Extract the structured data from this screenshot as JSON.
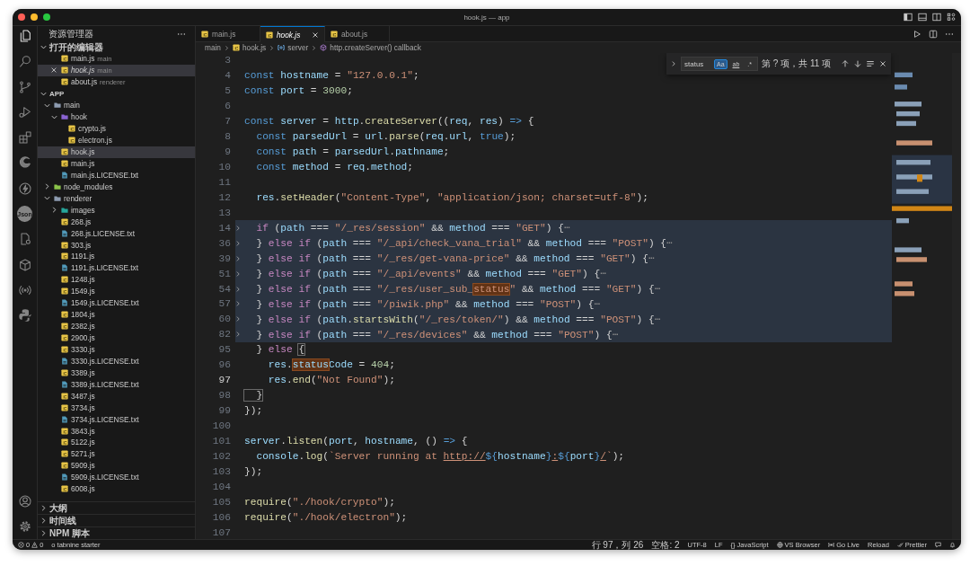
{
  "window": {
    "title": "hook.js — app"
  },
  "activity_bar": {
    "items": [
      {
        "kind": "explorer",
        "selected": true
      },
      {
        "kind": "search",
        "selected": false
      },
      {
        "kind": "source-control",
        "selected": false
      },
      {
        "kind": "run-debug",
        "selected": false
      },
      {
        "kind": "extensions",
        "selected": false
      },
      {
        "kind": "browser",
        "selected": false
      },
      {
        "kind": "lightning",
        "selected": false
      },
      {
        "kind": "json",
        "label": "Json",
        "selected": false
      },
      {
        "kind": "doc-gear",
        "selected": false
      },
      {
        "kind": "deploy",
        "selected": false
      },
      {
        "kind": "broadcast",
        "selected": false
      },
      {
        "kind": "python",
        "selected": false
      }
    ],
    "bottom": [
      {
        "kind": "account"
      },
      {
        "kind": "settings"
      }
    ]
  },
  "sidebar": {
    "title": "资源管理器",
    "open_editors": {
      "title": "打开的编辑器",
      "expanded": true,
      "items": [
        {
          "name": "main.js",
          "description": "main",
          "selected": false,
          "preview": false
        },
        {
          "name": "hook.js",
          "description": "main",
          "selected": true,
          "preview": true
        },
        {
          "name": "about.js",
          "description": "renderer",
          "selected": false,
          "preview": false
        }
      ]
    },
    "explorer": {
      "title": "APP",
      "expanded": true,
      "tree": [
        {
          "name": "main",
          "kind": "folder",
          "color": "#8d9bb0",
          "expanded": true,
          "selected": false,
          "children": [
            {
              "name": "hook",
              "kind": "folder",
              "color": "#8a63d2",
              "expanded": true,
              "selected": false,
              "children": [
                {
                  "name": "crypto.js",
                  "kind": "js",
                  "selected": false
                },
                {
                  "name": "electron.js",
                  "kind": "js",
                  "selected": false
                }
              ]
            },
            {
              "name": "hook.js",
              "kind": "js",
              "selected": true
            },
            {
              "name": "main.js",
              "kind": "js",
              "selected": false
            },
            {
              "name": "main.js.LICENSE.txt",
              "kind": "txt",
              "selected": false
            }
          ]
        },
        {
          "name": "node_modules",
          "kind": "folder",
          "color": "#8bc34a",
          "expanded": false,
          "selected": false
        },
        {
          "name": "renderer",
          "kind": "folder",
          "color": "#8d9bb0",
          "expanded": true,
          "selected": false,
          "children": [
            {
              "name": "images",
              "kind": "folder",
              "color": "#26a69a",
              "expanded": false,
              "selected": false
            },
            {
              "name": "268.js",
              "kind": "js",
              "selected": false
            },
            {
              "name": "268.js.LICENSE.txt",
              "kind": "txt",
              "selected": false
            },
            {
              "name": "303.js",
              "kind": "js",
              "selected": false
            },
            {
              "name": "1191.js",
              "kind": "js",
              "selected": false
            },
            {
              "name": "1191.js.LICENSE.txt",
              "kind": "txt",
              "selected": false
            },
            {
              "name": "1248.js",
              "kind": "js",
              "selected": false
            },
            {
              "name": "1549.js",
              "kind": "js",
              "selected": false
            },
            {
              "name": "1549.js.LICENSE.txt",
              "kind": "txt",
              "selected": false
            },
            {
              "name": "1804.js",
              "kind": "js",
              "selected": false
            },
            {
              "name": "2382.js",
              "kind": "js",
              "selected": false
            },
            {
              "name": "2900.js",
              "kind": "js",
              "selected": false
            },
            {
              "name": "3330.js",
              "kind": "js",
              "selected": false
            },
            {
              "name": "3330.js.LICENSE.txt",
              "kind": "txt",
              "selected": false
            },
            {
              "name": "3389.js",
              "kind": "js",
              "selected": false
            },
            {
              "name": "3389.js.LICENSE.txt",
              "kind": "txt",
              "selected": false
            },
            {
              "name": "3487.js",
              "kind": "js",
              "selected": false
            },
            {
              "name": "3734.js",
              "kind": "js",
              "selected": false
            },
            {
              "name": "3734.js.LICENSE.txt",
              "kind": "txt",
              "selected": false
            },
            {
              "name": "3843.js",
              "kind": "js",
              "selected": false
            },
            {
              "name": "5122.js",
              "kind": "js",
              "selected": false
            },
            {
              "name": "5271.js",
              "kind": "js",
              "selected": false
            },
            {
              "name": "5909.js",
              "kind": "js",
              "selected": false
            },
            {
              "name": "5909.js.LICENSE.txt",
              "kind": "txt",
              "selected": false
            },
            {
              "name": "6008.js",
              "kind": "js",
              "selected": false
            }
          ]
        }
      ]
    },
    "panels": [
      {
        "title": "大纲",
        "expanded": false
      },
      {
        "title": "时间线",
        "expanded": false
      },
      {
        "title": "NPM 脚本",
        "expanded": false
      }
    ]
  },
  "tabs": [
    {
      "label": "main.js",
      "selected": false,
      "preview": false
    },
    {
      "label": "hook.js",
      "selected": true,
      "preview": true
    },
    {
      "label": "about.js",
      "selected": false,
      "preview": false
    }
  ],
  "breadcrumbs": [
    {
      "label": "main",
      "kind": "folder"
    },
    {
      "label": "hook.js",
      "kind": "js"
    },
    {
      "label": "server",
      "kind": "variable"
    },
    {
      "label": "http.createServer() callback",
      "kind": "function"
    }
  ],
  "find": {
    "value": "status",
    "options": [
      {
        "kind": "case",
        "label": "Aa",
        "on": true
      },
      {
        "kind": "word",
        "label": "ab",
        "on": false
      },
      {
        "kind": "regex",
        "label": ".*",
        "on": false
      }
    ],
    "result": "第 ? 项，共 11 项"
  },
  "code": {
    "lines": [
      {
        "number": "3",
        "highlighted": false,
        "folded": false,
        "current": false
      },
      {
        "number": "4",
        "highlighted": false,
        "folded": false,
        "current": false,
        "tokens": [
          {
            "kind": "k",
            "text": "const "
          },
          {
            "kind": "v",
            "text": "hostname"
          },
          {
            "kind": "p",
            "text": " = "
          },
          {
            "kind": "s",
            "text": "\"127.0.0.1\""
          },
          {
            "kind": "p",
            "text": ";"
          }
        ]
      },
      {
        "number": "5",
        "highlighted": false,
        "folded": false,
        "current": false,
        "tokens": [
          {
            "kind": "k",
            "text": "const "
          },
          {
            "kind": "v",
            "text": "port"
          },
          {
            "kind": "p",
            "text": " = "
          },
          {
            "kind": "n",
            "text": "3000"
          },
          {
            "kind": "p",
            "text": ";"
          }
        ]
      },
      {
        "number": "6",
        "highlighted": false,
        "folded": false,
        "current": false
      },
      {
        "number": "7",
        "highlighted": false,
        "folded": false,
        "current": false,
        "tokens": [
          {
            "kind": "k",
            "text": "const "
          },
          {
            "kind": "v",
            "text": "server"
          },
          {
            "kind": "p",
            "text": " = "
          },
          {
            "kind": "v",
            "text": "http"
          },
          {
            "kind": "p",
            "text": "."
          },
          {
            "kind": "f",
            "text": "createServer"
          },
          {
            "kind": "p",
            "text": "(("
          },
          {
            "kind": "v",
            "text": "req"
          },
          {
            "kind": "p",
            "text": ", "
          },
          {
            "kind": "v",
            "text": "res"
          },
          {
            "kind": "p",
            "text": ") "
          },
          {
            "kind": "k",
            "text": "=>"
          },
          {
            "kind": "p",
            "text": " {"
          }
        ]
      },
      {
        "number": "8",
        "highlighted": false,
        "folded": false,
        "current": false,
        "tokens": [
          {
            "kind": "k",
            "text": "  const "
          },
          {
            "kind": "v",
            "text": "parsedUrl"
          },
          {
            "kind": "p",
            "text": " = "
          },
          {
            "kind": "v",
            "text": "url"
          },
          {
            "kind": "p",
            "text": "."
          },
          {
            "kind": "f",
            "text": "parse"
          },
          {
            "kind": "p",
            "text": "("
          },
          {
            "kind": "v",
            "text": "req"
          },
          {
            "kind": "p",
            "text": "."
          },
          {
            "kind": "v",
            "text": "url"
          },
          {
            "kind": "p",
            "text": ", "
          },
          {
            "kind": "k",
            "text": "true"
          },
          {
            "kind": "p",
            "text": ");"
          }
        ]
      },
      {
        "number": "9",
        "highlighted": false,
        "folded": false,
        "current": false,
        "tokens": [
          {
            "kind": "k",
            "text": "  const "
          },
          {
            "kind": "v",
            "text": "path"
          },
          {
            "kind": "p",
            "text": " = "
          },
          {
            "kind": "v",
            "text": "parsedUrl"
          },
          {
            "kind": "p",
            "text": "."
          },
          {
            "kind": "v",
            "text": "pathname"
          },
          {
            "kind": "p",
            "text": ";"
          }
        ]
      },
      {
        "number": "10",
        "highlighted": false,
        "folded": false,
        "current": false,
        "tokens": [
          {
            "kind": "k",
            "text": "  const "
          },
          {
            "kind": "v",
            "text": "method"
          },
          {
            "kind": "p",
            "text": " = "
          },
          {
            "kind": "v",
            "text": "req"
          },
          {
            "kind": "p",
            "text": "."
          },
          {
            "kind": "v",
            "text": "method"
          },
          {
            "kind": "p",
            "text": ";"
          }
        ]
      },
      {
        "number": "11",
        "highlighted": false,
        "folded": false,
        "current": false
      },
      {
        "number": "12",
        "highlighted": false,
        "folded": false,
        "current": false,
        "tokens": [
          {
            "kind": "v",
            "text": "  res"
          },
          {
            "kind": "p",
            "text": "."
          },
          {
            "kind": "f",
            "text": "setHeader"
          },
          {
            "kind": "p",
            "text": "("
          },
          {
            "kind": "s",
            "text": "\"Content-Type\""
          },
          {
            "kind": "p",
            "text": ", "
          },
          {
            "kind": "s",
            "text": "\"application/json; charset=utf-8\""
          },
          {
            "kind": "p",
            "text": ");"
          }
        ]
      },
      {
        "number": "13",
        "highlighted": false,
        "folded": false,
        "current": false
      },
      {
        "number": "14",
        "highlighted": true,
        "folded": true,
        "current": false,
        "tokens": [
          {
            "kind": "c",
            "text": "  if"
          },
          {
            "kind": "p",
            "text": " ("
          },
          {
            "kind": "v",
            "text": "path"
          },
          {
            "kind": "p",
            "text": " === "
          },
          {
            "kind": "s",
            "text": "\"/_res/session\""
          },
          {
            "kind": "p",
            "text": " && "
          },
          {
            "kind": "v",
            "text": "method"
          },
          {
            "kind": "p",
            "text": " === "
          },
          {
            "kind": "s",
            "text": "\"GET\""
          },
          {
            "kind": "p",
            "text": ") {"
          },
          {
            "kind": "e",
            "text": "⋯"
          }
        ]
      },
      {
        "number": "36",
        "highlighted": true,
        "folded": true,
        "current": false,
        "tokens": [
          {
            "kind": "p",
            "text": "  } "
          },
          {
            "kind": "c",
            "text": "else if"
          },
          {
            "kind": "p",
            "text": " ("
          },
          {
            "kind": "v",
            "text": "path"
          },
          {
            "kind": "p",
            "text": " === "
          },
          {
            "kind": "s",
            "text": "\"/_api/check_vana_trial\""
          },
          {
            "kind": "p",
            "text": " && "
          },
          {
            "kind": "v",
            "text": "method"
          },
          {
            "kind": "p",
            "text": " === "
          },
          {
            "kind": "s",
            "text": "\"POST\""
          },
          {
            "kind": "p",
            "text": ") {"
          },
          {
            "kind": "e",
            "text": "⋯"
          }
        ]
      },
      {
        "number": "39",
        "highlighted": true,
        "folded": true,
        "current": false,
        "tokens": [
          {
            "kind": "p",
            "text": "  } "
          },
          {
            "kind": "c",
            "text": "else if"
          },
          {
            "kind": "p",
            "text": " ("
          },
          {
            "kind": "v",
            "text": "path"
          },
          {
            "kind": "p",
            "text": " === "
          },
          {
            "kind": "s",
            "text": "\"/_res/get-vana-price\""
          },
          {
            "kind": "p",
            "text": " && "
          },
          {
            "kind": "v",
            "text": "method"
          },
          {
            "kind": "p",
            "text": " === "
          },
          {
            "kind": "s",
            "text": "\"GET\""
          },
          {
            "kind": "p",
            "text": ") {"
          },
          {
            "kind": "e",
            "text": "⋯"
          }
        ]
      },
      {
        "number": "51",
        "highlighted": true,
        "folded": true,
        "current": false,
        "tokens": [
          {
            "kind": "p",
            "text": "  } "
          },
          {
            "kind": "c",
            "text": "else if"
          },
          {
            "kind": "p",
            "text": " ("
          },
          {
            "kind": "v",
            "text": "path"
          },
          {
            "kind": "p",
            "text": " === "
          },
          {
            "kind": "s",
            "text": "\"/_api/events\""
          },
          {
            "kind": "p",
            "text": " && "
          },
          {
            "kind": "v",
            "text": "method"
          },
          {
            "kind": "p",
            "text": " === "
          },
          {
            "kind": "s",
            "text": "\"GET\""
          },
          {
            "kind": "p",
            "text": ") {"
          },
          {
            "kind": "e",
            "text": "⋯"
          }
        ]
      },
      {
        "number": "54",
        "highlighted": true,
        "folded": true,
        "current": false,
        "tokens": [
          {
            "kind": "p",
            "text": "  } "
          },
          {
            "kind": "c",
            "text": "else if"
          },
          {
            "kind": "p",
            "text": " ("
          },
          {
            "kind": "v",
            "text": "path"
          },
          {
            "kind": "p",
            "text": " === "
          },
          {
            "kind": "s",
            "text": "\"/_res/user_sub_"
          },
          {
            "kind": "ms",
            "text": "status"
          },
          {
            "kind": "s",
            "text": "\""
          },
          {
            "kind": "p",
            "text": " && "
          },
          {
            "kind": "v",
            "text": "method"
          },
          {
            "kind": "p",
            "text": " === "
          },
          {
            "kind": "s",
            "text": "\"GET\""
          },
          {
            "kind": "p",
            "text": ") {"
          },
          {
            "kind": "e",
            "text": "⋯"
          }
        ]
      },
      {
        "number": "57",
        "highlighted": true,
        "folded": true,
        "current": false,
        "tokens": [
          {
            "kind": "p",
            "text": "  } "
          },
          {
            "kind": "c",
            "text": "else if"
          },
          {
            "kind": "p",
            "text": " ("
          },
          {
            "kind": "v",
            "text": "path"
          },
          {
            "kind": "p",
            "text": " === "
          },
          {
            "kind": "s",
            "text": "\"/piwik.php\""
          },
          {
            "kind": "p",
            "text": " && "
          },
          {
            "kind": "v",
            "text": "method"
          },
          {
            "kind": "p",
            "text": " === "
          },
          {
            "kind": "s",
            "text": "\"POST\""
          },
          {
            "kind": "p",
            "text": ") {"
          },
          {
            "kind": "e",
            "text": "⋯"
          }
        ]
      },
      {
        "number": "60",
        "highlighted": true,
        "folded": true,
        "current": false,
        "tokens": [
          {
            "kind": "p",
            "text": "  } "
          },
          {
            "kind": "c",
            "text": "else if"
          },
          {
            "kind": "p",
            "text": " ("
          },
          {
            "kind": "v",
            "text": "path"
          },
          {
            "kind": "p",
            "text": "."
          },
          {
            "kind": "f",
            "text": "startsWith"
          },
          {
            "kind": "p",
            "text": "("
          },
          {
            "kind": "s",
            "text": "\"/_res/token/\""
          },
          {
            "kind": "p",
            "text": ") && "
          },
          {
            "kind": "v",
            "text": "method"
          },
          {
            "kind": "p",
            "text": " === "
          },
          {
            "kind": "s",
            "text": "\"POST\""
          },
          {
            "kind": "p",
            "text": ") {"
          },
          {
            "kind": "e",
            "text": "⋯"
          }
        ]
      },
      {
        "number": "82",
        "highlighted": true,
        "folded": true,
        "current": false,
        "tokens": [
          {
            "kind": "p",
            "text": "  } "
          },
          {
            "kind": "c",
            "text": "else if"
          },
          {
            "kind": "p",
            "text": " ("
          },
          {
            "kind": "v",
            "text": "path"
          },
          {
            "kind": "p",
            "text": " === "
          },
          {
            "kind": "s",
            "text": "\"/_res/devices\""
          },
          {
            "kind": "p",
            "text": " && "
          },
          {
            "kind": "v",
            "text": "method"
          },
          {
            "kind": "p",
            "text": " === "
          },
          {
            "kind": "s",
            "text": "\"POST\""
          },
          {
            "kind": "p",
            "text": ") {"
          },
          {
            "kind": "e",
            "text": "⋯"
          }
        ]
      },
      {
        "number": "95",
        "highlighted": false,
        "folded": false,
        "current": false,
        "tokens": [
          {
            "kind": "p",
            "text": "  } "
          },
          {
            "kind": "c",
            "text": "else "
          },
          {
            "kind": "b",
            "text": "{"
          }
        ]
      },
      {
        "number": "96",
        "highlighted": false,
        "folded": false,
        "current": false,
        "tokens": [
          {
            "kind": "v",
            "text": "    res"
          },
          {
            "kind": "p",
            "text": "."
          },
          {
            "kind": "mv",
            "text": "status"
          },
          {
            "kind": "v",
            "text": "Code"
          },
          {
            "kind": "p",
            "text": " = "
          },
          {
            "kind": "n",
            "text": "404"
          },
          {
            "kind": "p",
            "text": ";"
          }
        ]
      },
      {
        "number": "97",
        "highlighted": false,
        "folded": false,
        "current": true,
        "tokens": [
          {
            "kind": "v",
            "text": "    res"
          },
          {
            "kind": "p",
            "text": "."
          },
          {
            "kind": "f",
            "text": "end"
          },
          {
            "kind": "p",
            "text": "("
          },
          {
            "kind": "s",
            "text": "\"Not Found\""
          },
          {
            "kind": "p",
            "text": ");"
          }
        ]
      },
      {
        "number": "98",
        "highlighted": false,
        "folded": false,
        "current": false,
        "tokens": [
          {
            "kind": "b",
            "text": "  }"
          }
        ]
      },
      {
        "number": "99",
        "highlighted": false,
        "folded": false,
        "current": false,
        "tokens": [
          {
            "kind": "p",
            "text": "});"
          }
        ]
      },
      {
        "number": "100",
        "highlighted": false,
        "folded": false,
        "current": false
      },
      {
        "number": "101",
        "highlighted": false,
        "folded": false,
        "current": false,
        "tokens": [
          {
            "kind": "v",
            "text": "server"
          },
          {
            "kind": "p",
            "text": "."
          },
          {
            "kind": "f",
            "text": "listen"
          },
          {
            "kind": "p",
            "text": "("
          },
          {
            "kind": "v",
            "text": "port"
          },
          {
            "kind": "p",
            "text": ", "
          },
          {
            "kind": "v",
            "text": "hostname"
          },
          {
            "kind": "p",
            "text": ", () "
          },
          {
            "kind": "k",
            "text": "=>"
          },
          {
            "kind": "p",
            "text": " {"
          }
        ]
      },
      {
        "number": "102",
        "highlighted": false,
        "folded": false,
        "current": false,
        "tokens": [
          {
            "kind": "v",
            "text": "  console"
          },
          {
            "kind": "p",
            "text": "."
          },
          {
            "kind": "f",
            "text": "log"
          },
          {
            "kind": "p",
            "text": "("
          },
          {
            "kind": "s",
            "text": "`Server running at "
          },
          {
            "kind": "u",
            "text": "http://"
          },
          {
            "kind": "k",
            "text": "${"
          },
          {
            "kind": "v",
            "text": "hostname"
          },
          {
            "kind": "k",
            "text": "}"
          },
          {
            "kind": "u",
            "text": ":"
          },
          {
            "kind": "k",
            "text": "${"
          },
          {
            "kind": "v",
            "text": "port"
          },
          {
            "kind": "k",
            "text": "}"
          },
          {
            "kind": "u",
            "text": "/"
          },
          {
            "kind": "s",
            "text": "`"
          },
          {
            "kind": "p",
            "text": ");"
          }
        ]
      },
      {
        "number": "103",
        "highlighted": false,
        "folded": false,
        "current": false,
        "tokens": [
          {
            "kind": "p",
            "text": "});"
          }
        ]
      },
      {
        "number": "104",
        "highlighted": false,
        "folded": false,
        "current": false
      },
      {
        "number": "105",
        "highlighted": false,
        "folded": false,
        "current": false,
        "tokens": [
          {
            "kind": "f",
            "text": "require"
          },
          {
            "kind": "p",
            "text": "("
          },
          {
            "kind": "s",
            "text": "\"./hook/crypto\""
          },
          {
            "kind": "p",
            "text": ");"
          }
        ]
      },
      {
        "number": "106",
        "highlighted": false,
        "folded": false,
        "current": false,
        "tokens": [
          {
            "kind": "f",
            "text": "require"
          },
          {
            "kind": "p",
            "text": "("
          },
          {
            "kind": "s",
            "text": "\"./hook/electron\""
          },
          {
            "kind": "p",
            "text": ");"
          }
        ]
      },
      {
        "number": "107",
        "highlighted": false,
        "folded": false,
        "current": false
      }
    ]
  },
  "status_bar": {
    "problems": {
      "errors": "0",
      "warnings": "0"
    },
    "left": [
      {
        "label": "o tabnine starter"
      }
    ],
    "right": [
      {
        "label": "行 97，列 26"
      },
      {
        "label": "空格: 2"
      },
      {
        "label": "UTF-8"
      },
      {
        "label": "LF"
      },
      {
        "icon": "{}",
        "label": "JavaScript"
      },
      {
        "kind": "globe",
        "label": "VS Browser"
      },
      {
        "kind": "broadcast",
        "label": "Go Live"
      },
      {
        "label": "Reload"
      },
      {
        "kind": "check",
        "label": "Prettier"
      },
      {
        "kind": "feedback"
      },
      {
        "kind": "bell"
      }
    ]
  }
}
